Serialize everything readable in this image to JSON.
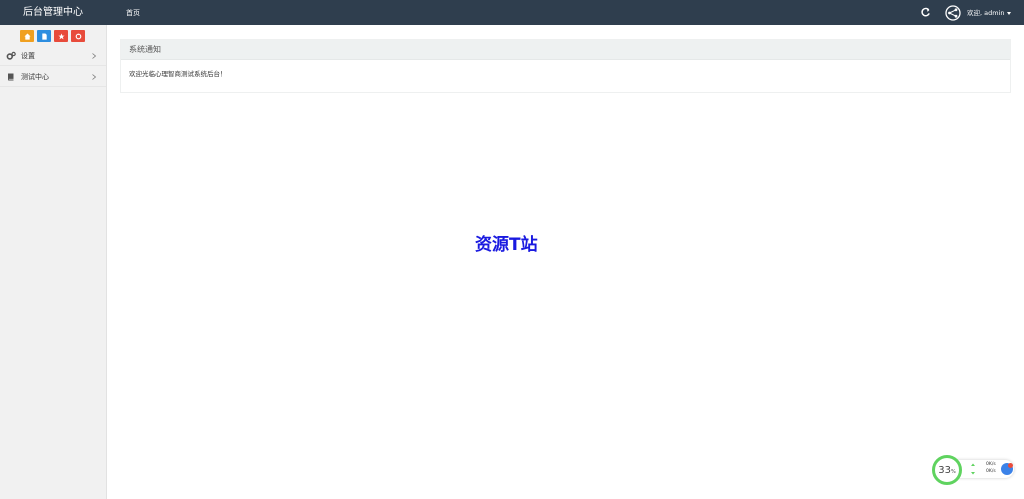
{
  "header": {
    "brand": "后台管理中心",
    "nav_home": "首页",
    "welcome": "欢迎, admin",
    "refresh_icon": "refresh-icon",
    "avatar_icon": "avatar-icon"
  },
  "sidebar": {
    "shortcuts": [
      {
        "icon": "home-icon",
        "color": "#f0a020"
      },
      {
        "icon": "file-icon",
        "color": "#2d8ee0"
      },
      {
        "icon": "star-icon",
        "color": "#e84b3b"
      },
      {
        "icon": "recycle-icon",
        "color": "#e84b3b"
      }
    ],
    "items": [
      {
        "label": "设置",
        "icon": "gears-icon"
      },
      {
        "label": "测试中心",
        "icon": "book-icon"
      }
    ]
  },
  "main": {
    "panel_title": "系统通知",
    "panel_text": "欢迎光临心理智商测试系统后台！",
    "watermark": "资源T站"
  },
  "widget": {
    "percent": "33",
    "percent_unit": "%",
    "upload_speed": "0K/s",
    "download_speed": "0K/s",
    "ring_color": "#5fd35f"
  }
}
